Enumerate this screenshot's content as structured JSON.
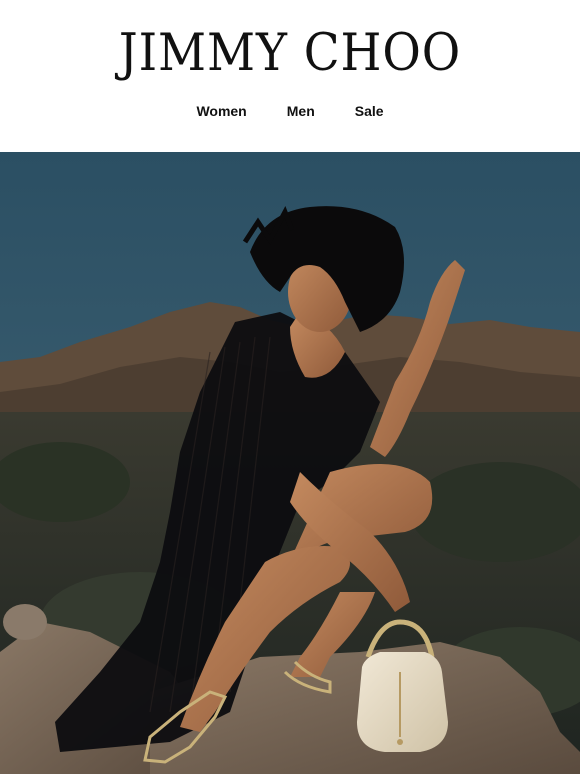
{
  "brand": {
    "logo_text": "JIMMY CHOO"
  },
  "nav": {
    "items": [
      {
        "label": "Women"
      },
      {
        "label": "Men"
      },
      {
        "label": "Sale"
      }
    ]
  },
  "hero": {
    "image_subject": "model-in-black-fringe-dress-with-white-bucket-bag",
    "colors": {
      "sky_top": "#2b4f63",
      "sky_bottom": "#3e6478",
      "hills": "#5d4a3a",
      "scrub": "#2d3528",
      "rock": "#7b6a5a",
      "skin": "#b57a52",
      "dress": "#0d0d10",
      "bag": "#e8ddc8",
      "metal": "#c9b27a"
    }
  }
}
